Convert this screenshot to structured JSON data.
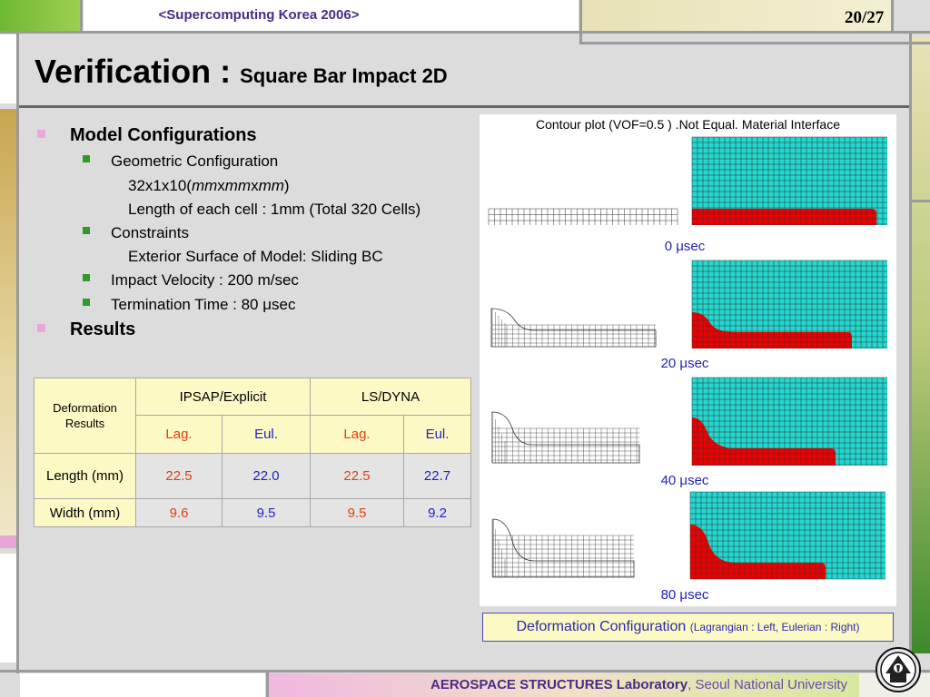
{
  "header": {
    "event": "<Supercomputing Korea 2006>",
    "page": "20/27"
  },
  "title": {
    "main": "Verification : ",
    "sub": "Square Bar Impact 2D"
  },
  "outline": {
    "model_configurations": "Model Configurations",
    "geometric": "Geometric Configuration",
    "dims_prefix": "32x1x10(",
    "dims_unit1": "mm",
    "dims_x1": "x",
    "dims_unit2": "mm",
    "dims_x2": "x",
    "dims_unit3": "mm",
    "dims_suffix": ")",
    "cell_length": "Length of each cell : 1mm (Total 320 Cells)",
    "constraints": "Constraints",
    "exterior": "Exterior Surface of Model: Sliding BC",
    "impact_velocity": "Impact Velocity : 200 m/sec",
    "termination": "Termination Time : 80 μsec",
    "results": "Results"
  },
  "table": {
    "corner": "Deformation Results",
    "col_groups": [
      "IPSAP/Explicit",
      "LS/DYNA"
    ],
    "sub_cols": [
      "Lag.",
      "Eul.",
      "Lag.",
      "Eul."
    ],
    "rows": [
      {
        "label": "Length (mm)",
        "values": [
          "22.5",
          "22.0",
          "22.5",
          "22.7"
        ]
      },
      {
        "label": "Width (mm)",
        "values": [
          "9.6",
          "9.5",
          "9.5",
          "9.2"
        ]
      }
    ]
  },
  "figure": {
    "title": "Contour plot (VOF=0.5 ) .Not Equal. Material Interface",
    "time_labels": [
      "0 μsec",
      "20 μsec",
      "40 μsec",
      "80 μsec"
    ],
    "colors": {
      "fluid": "#22d8d0",
      "material": "#ee0000",
      "grid": "#333333"
    }
  },
  "caption": {
    "main": "Deformation Configuration ",
    "detail": "(Lagrangian : Left, Eulerian : Right)"
  },
  "footer": {
    "lab": "AEROSPACE STRUCTURES Laboratory",
    "sep": ", ",
    "university": "Seoul National University"
  },
  "colors": {
    "title_purple": "#4a2c86",
    "bullet_pink": "#e9a7dc",
    "bullet_green": "#2f9a2a",
    "table_yellow": "#fdf9c4",
    "lag_red": "#e04010",
    "eul_blue": "#1e1ec8"
  }
}
